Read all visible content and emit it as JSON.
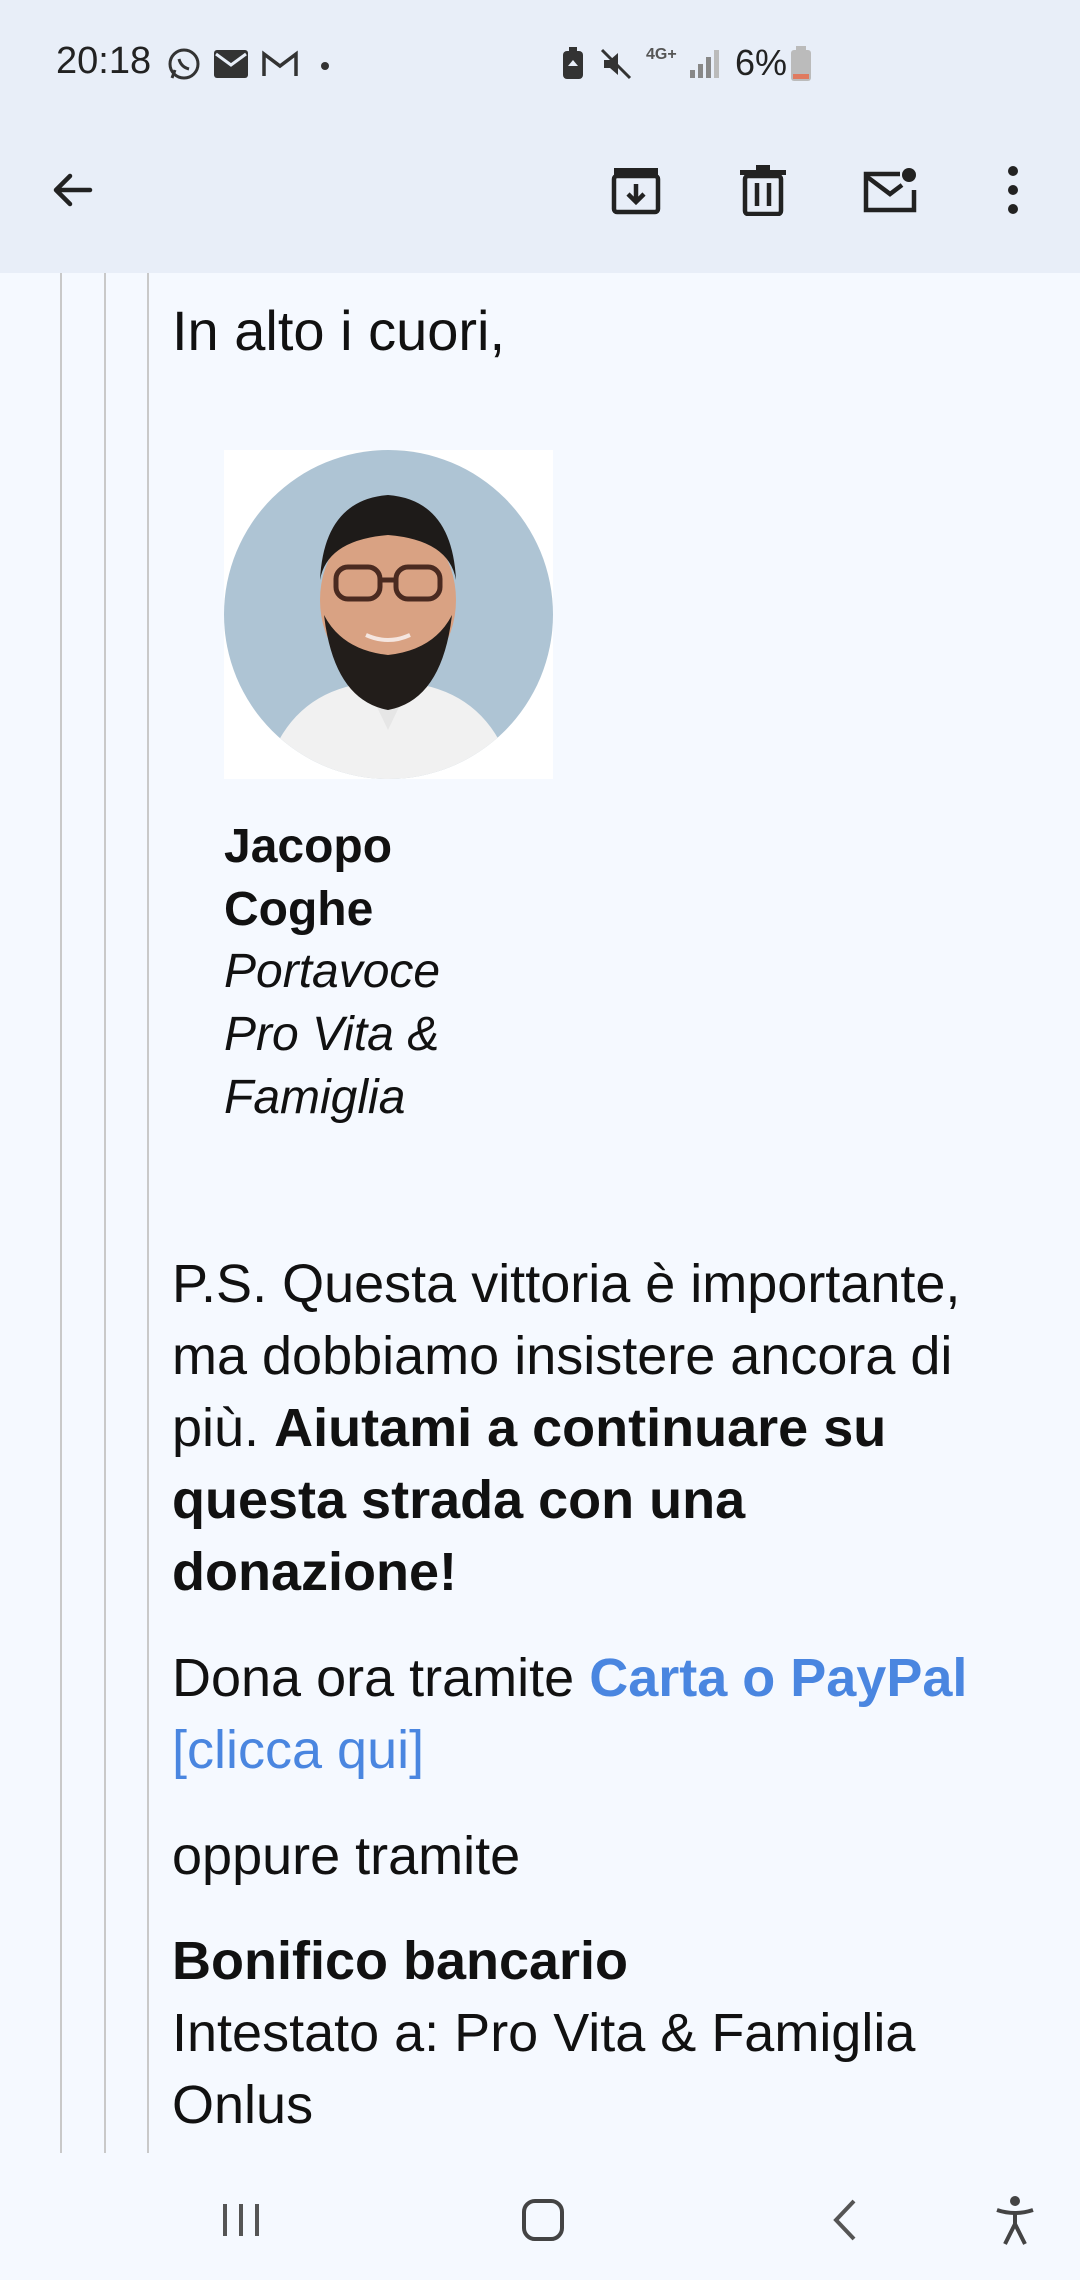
{
  "status_bar": {
    "time": "20:18",
    "network": "4G+",
    "battery": "6%",
    "notification_icons": [
      "whatsapp-icon",
      "email-icon",
      "gmail-icon",
      "dot-icon"
    ],
    "system_icons": [
      "battery-saver-icon",
      "mute-icon",
      "network-icon",
      "signal-icon",
      "battery-icon"
    ]
  },
  "toolbar": {
    "actions": [
      "back",
      "archive",
      "delete",
      "mark-unread",
      "more"
    ]
  },
  "email": {
    "greeting": "In alto i cuori,",
    "signature": {
      "name": "Jacopo Coghe",
      "role": "Portavoce Pro Vita & Famiglia"
    },
    "ps_text": "P.S. Questa vittoria è importante, ma dobbiamo insistere ancora di più.",
    "ps_bold": "Aiutami a continuare su questa strada con una donazione!",
    "donate_prefix": "Dona ora tramite",
    "donate_link_bold": "Carta o PayPal",
    "donate_link": "[clicca qui]",
    "oppure": "oppure tramite",
    "bank_title": "Bonifico bancario",
    "bank_holder": "Intestato a: Pro Vita & Famiglia Onlus"
  },
  "colors": {
    "link": "#4a86e0",
    "header_bg": "#e8eef8",
    "body_bg": "#f5f9ff"
  }
}
